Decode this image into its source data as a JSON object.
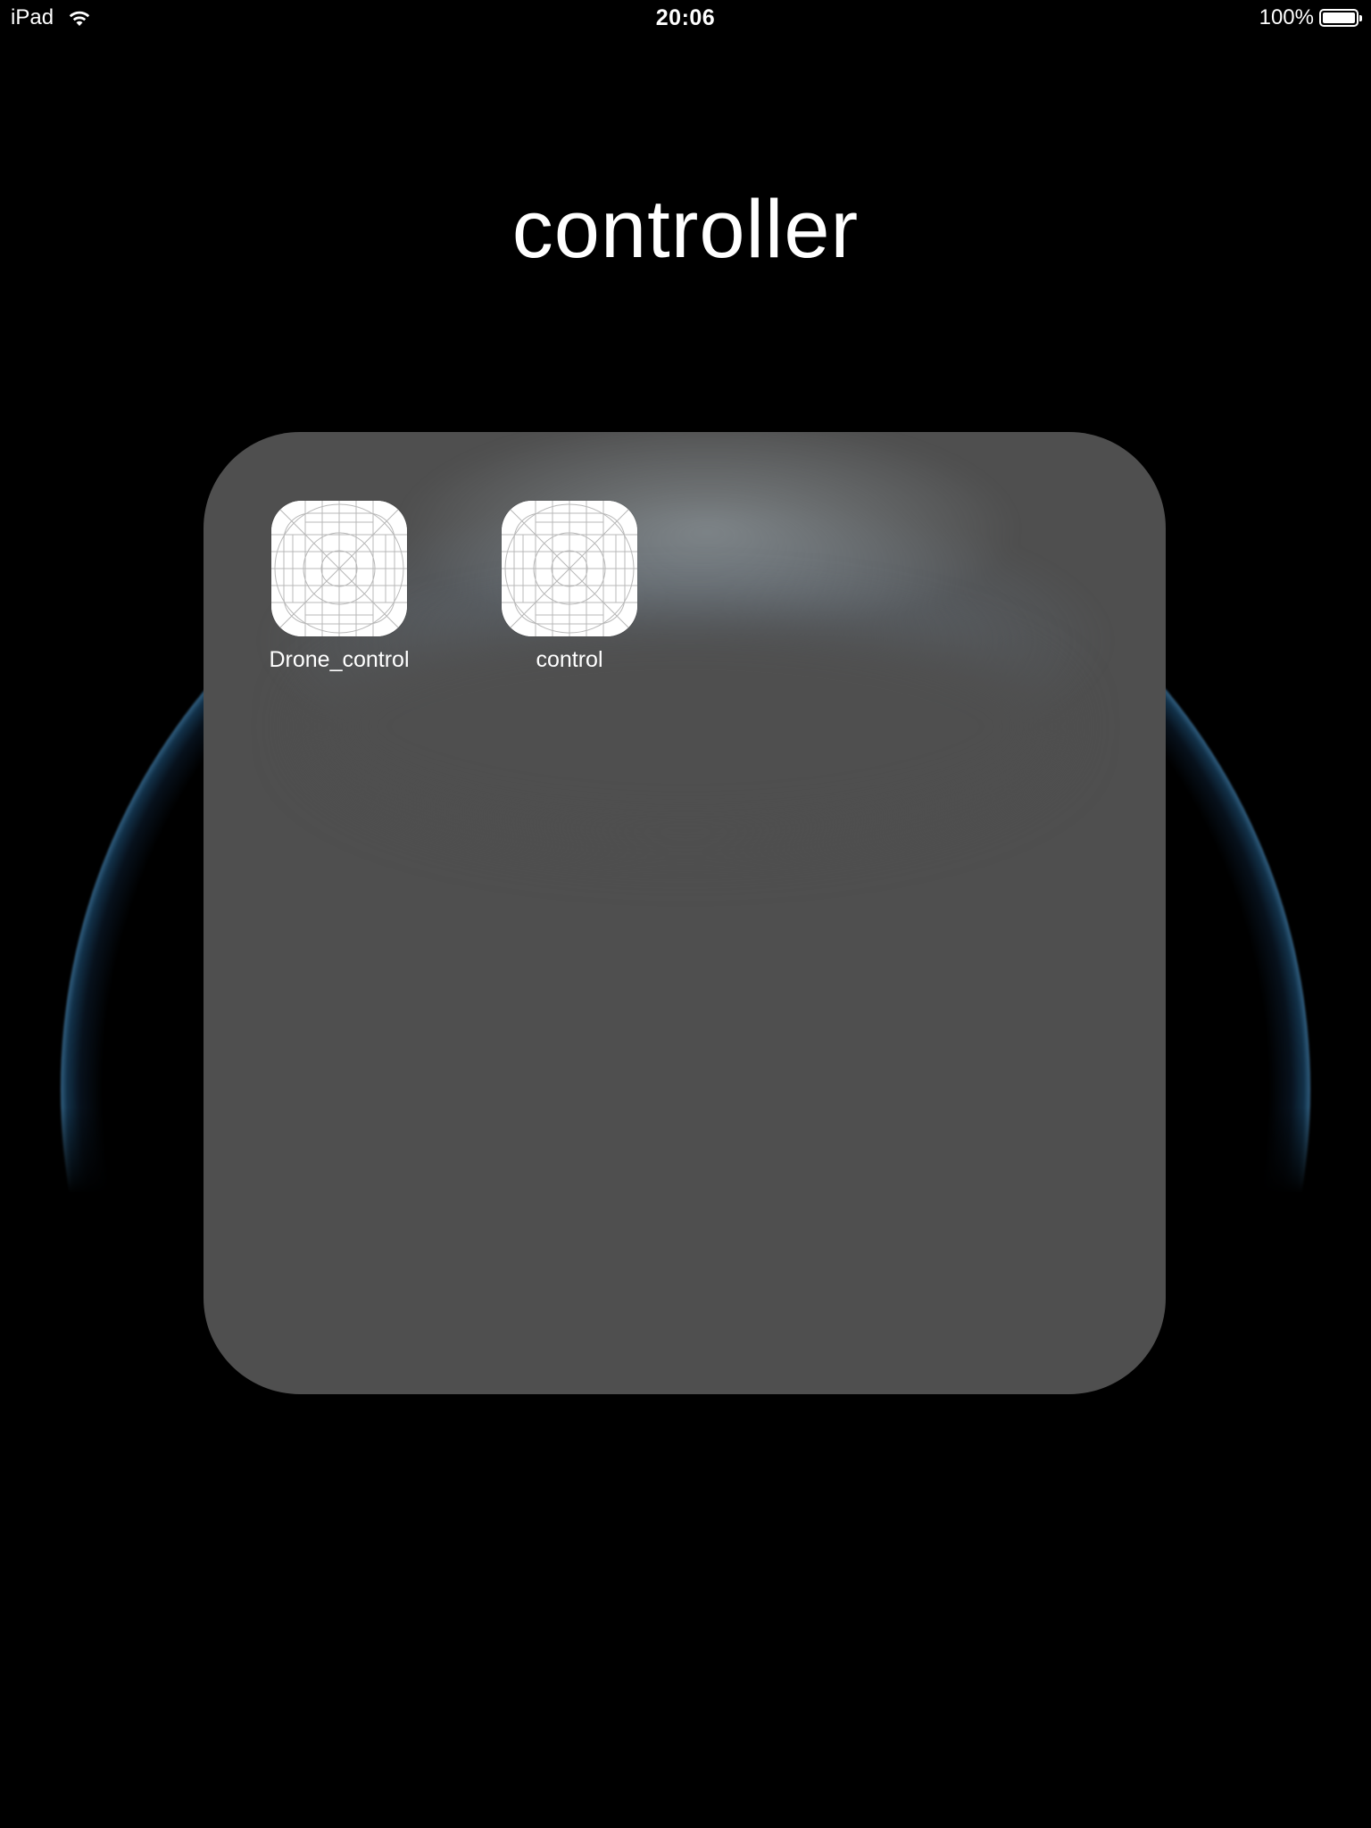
{
  "status_bar": {
    "device": "iPad",
    "time": "20:06",
    "battery_percent": "100%",
    "battery_level": 1.0,
    "icons": {
      "wifi": "wifi-icon",
      "battery": "battery-icon"
    }
  },
  "folder": {
    "title": "controller",
    "background_color": "#4f4f4f",
    "apps": [
      {
        "label": "Drone_control",
        "icon": "app-placeholder-grid-icon"
      },
      {
        "label": "control",
        "icon": "app-placeholder-grid-icon"
      }
    ]
  },
  "wallpaper": {
    "name": "planet-earth-wallpaper",
    "base_color": "#000000",
    "rim_color": "#5f85a8"
  }
}
